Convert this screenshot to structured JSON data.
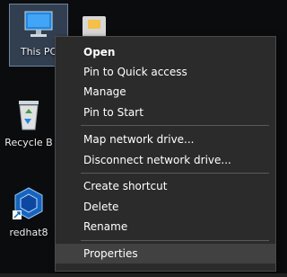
{
  "desktop": {
    "icons": [
      {
        "label": "This PC"
      },
      {
        "label": "Recycle B"
      },
      {
        "label": "redhat8"
      }
    ]
  },
  "context_menu": {
    "groups": [
      [
        "Open",
        "Pin to Quick access",
        "Manage",
        "Pin to Start"
      ],
      [
        "Map network drive...",
        "Disconnect network drive..."
      ],
      [
        "Create shortcut",
        "Delete",
        "Rename"
      ],
      [
        "Properties"
      ]
    ],
    "default_item": "Open",
    "highlighted_item": "Properties"
  },
  "colors": {
    "menu_bg": "#2b2b2b",
    "menu_hover": "#414141",
    "menu_text": "#ffffff",
    "separator": "#5a5a5a",
    "desktop_bg": "#0b0c0d",
    "selection": "#7aa0d2"
  }
}
